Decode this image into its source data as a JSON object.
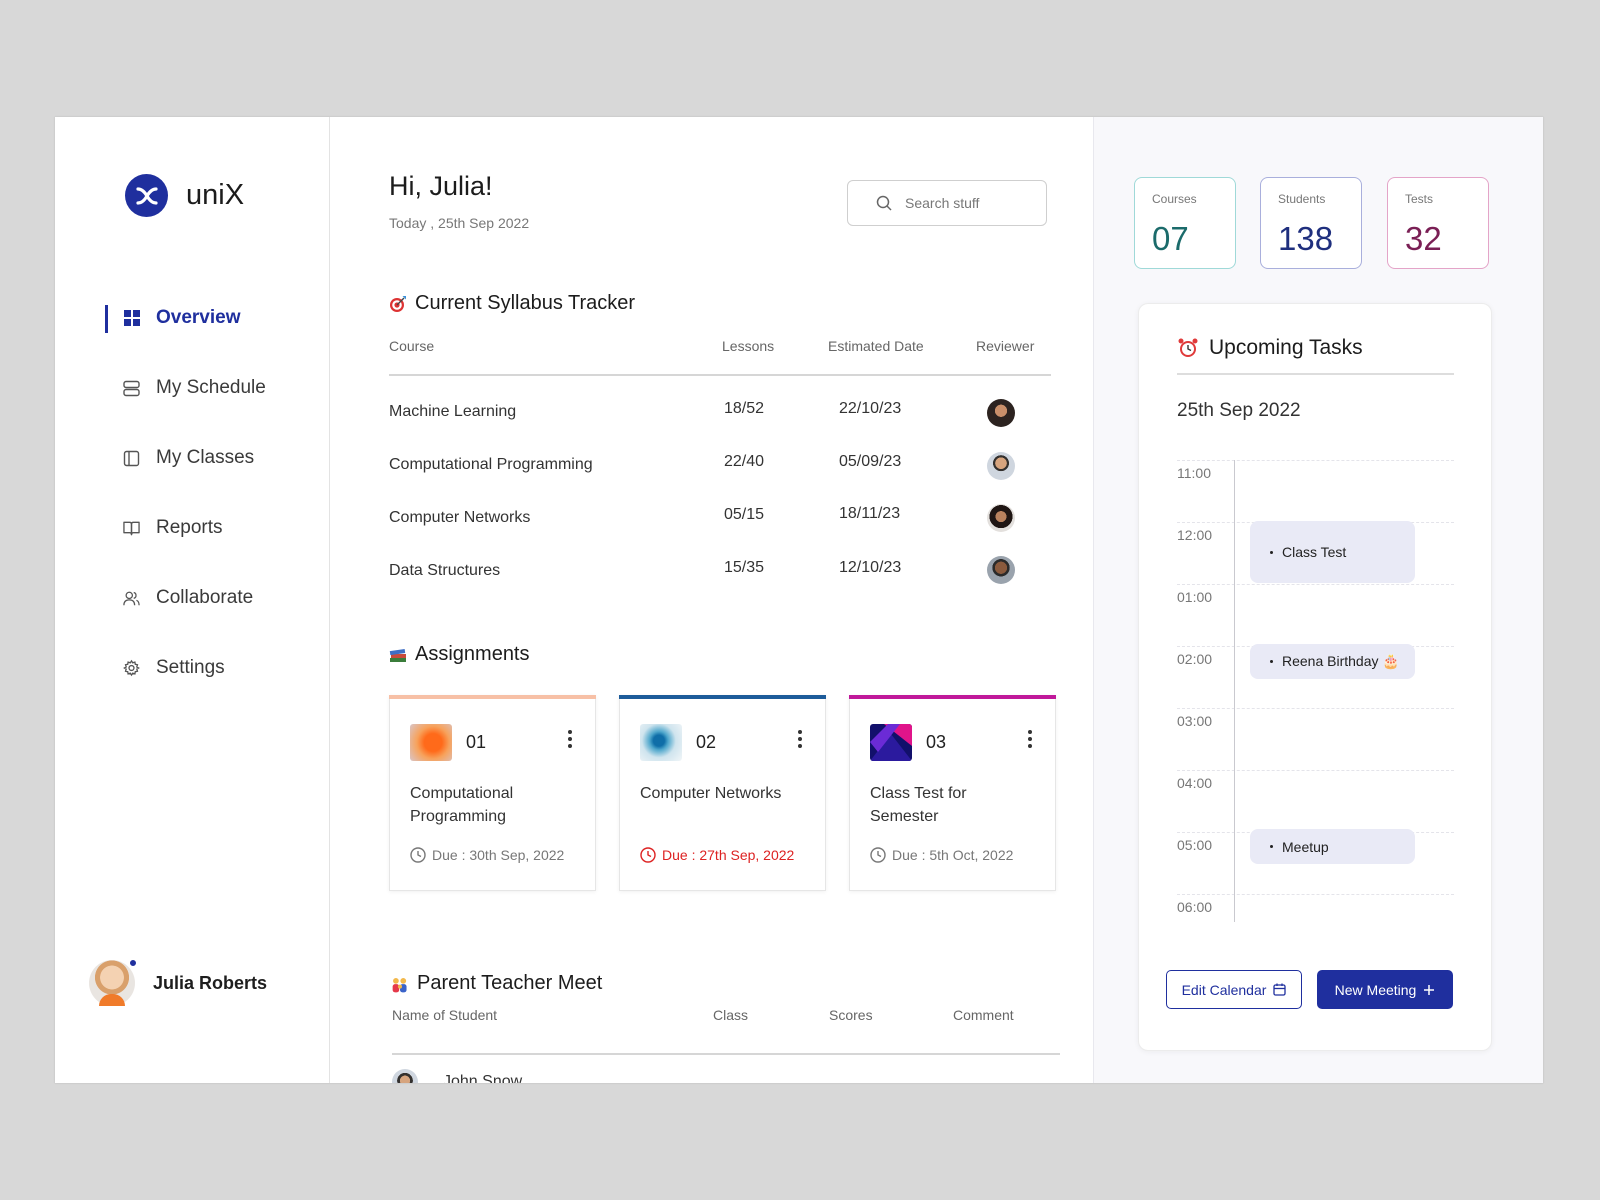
{
  "brand": {
    "name": "uniX"
  },
  "sidebar": {
    "items": [
      {
        "label": "Overview",
        "icon": "grid-icon",
        "active": true
      },
      {
        "label": "My Schedule",
        "icon": "schedule-icon"
      },
      {
        "label": "My Classes",
        "icon": "classes-icon"
      },
      {
        "label": "Reports",
        "icon": "book-icon"
      },
      {
        "label": "Collaborate",
        "icon": "users-icon"
      },
      {
        "label": "Settings",
        "icon": "gear-icon"
      }
    ],
    "user": {
      "name": "Julia Roberts"
    }
  },
  "header": {
    "greeting": "Hi, Julia!",
    "date": "Today , 25th Sep 2022",
    "search_placeholder": "Search stuff"
  },
  "tracker": {
    "title": "Current Syllabus Tracker",
    "columns": [
      "Course",
      "Lessons",
      "Estimated Date",
      "Reviewer"
    ],
    "rows": [
      {
        "course": "Machine Learning",
        "lessons": "18/52",
        "date": "22/10/23"
      },
      {
        "course": "Computational Programming",
        "lessons": "22/40",
        "date": "05/09/23"
      },
      {
        "course": "Computer Networks",
        "lessons": "05/15",
        "date": "18/11/23"
      },
      {
        "course": "Data Structures",
        "lessons": "15/35",
        "date": "12/10/23"
      }
    ]
  },
  "assignments": {
    "title": "Assignments",
    "due_label": "Due :",
    "cards": [
      {
        "num": "01",
        "name": "Computational Programming",
        "due": "30th Sep, 2022",
        "accent": "#f7c0a6"
      },
      {
        "num": "02",
        "name": "Computer Networks",
        "due": "27th Sep, 2022",
        "accent": "#1d5c9a",
        "overdue": true
      },
      {
        "num": "03",
        "name": "Class Test for Semester",
        "due": "5th Oct, 2022",
        "accent": "#c0189a"
      }
    ]
  },
  "ptm": {
    "title": "Parent Teacher Meet",
    "columns": [
      "Name of Student",
      "Class",
      "Scores",
      "Comment"
    ],
    "first_row_name": "John Snow"
  },
  "stats": [
    {
      "label": "Courses",
      "value": "07",
      "color": "#1b6b6b",
      "border": "#9fd9d8"
    },
    {
      "label": "Students",
      "value": "138",
      "color": "#1f2f7e",
      "border": "#a9afdc"
    },
    {
      "label": "Tests",
      "value": "32",
      "color": "#7a1f55",
      "border": "#e4a4c8"
    }
  ],
  "tasks": {
    "title": "Upcoming Tasks",
    "date": "25th Sep 2022",
    "times": [
      "11:00",
      "12:00",
      "01:00",
      "02:00",
      "03:00",
      "04:00",
      "05:00",
      "06:00"
    ],
    "events": [
      {
        "label": "Class Test"
      },
      {
        "label": "Reena Birthday 🎂"
      },
      {
        "label": "Meetup"
      }
    ],
    "edit_label": "Edit Calendar",
    "new_label": "New Meeting"
  },
  "colors": {
    "primary": "#1f2f9e",
    "danger": "#d22222"
  }
}
